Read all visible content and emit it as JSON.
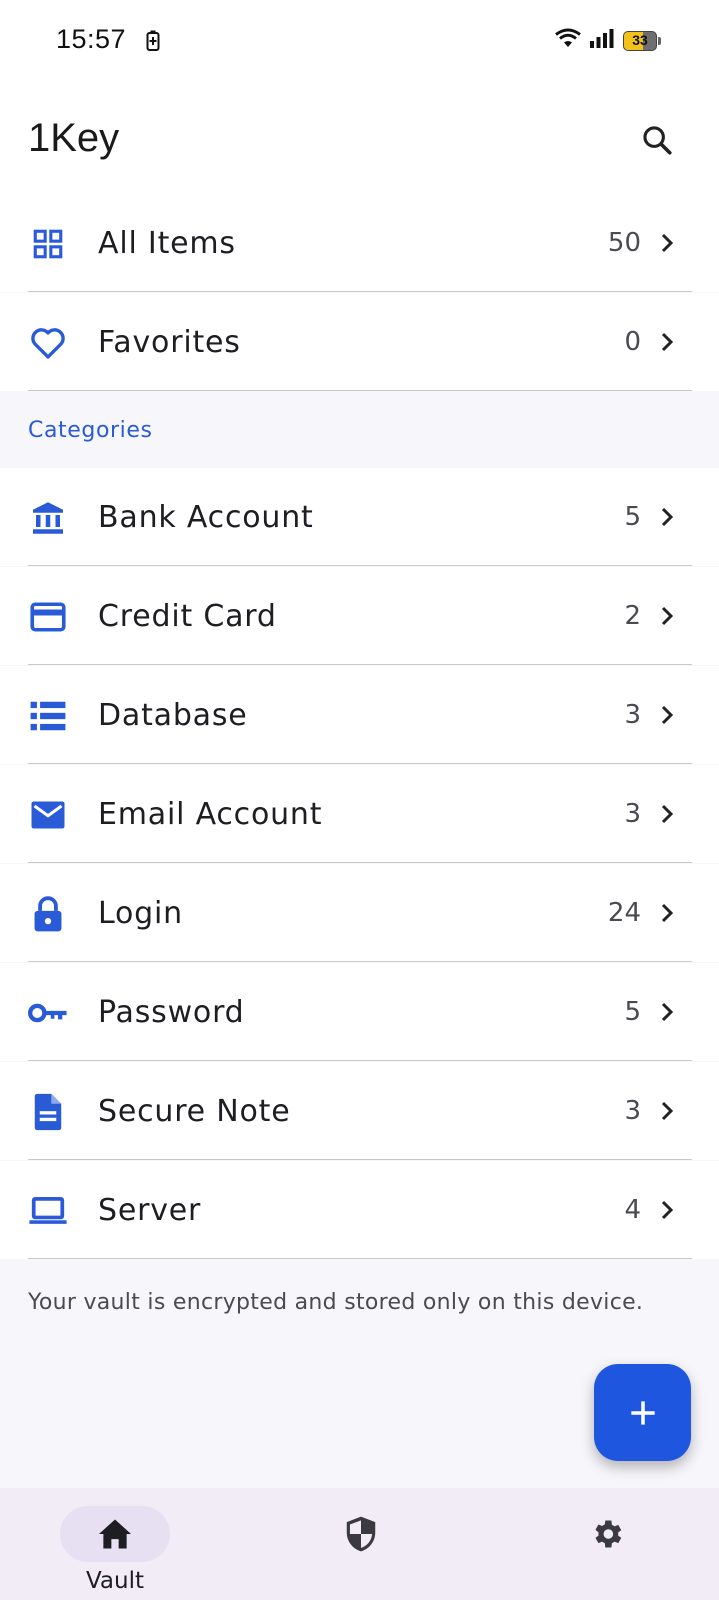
{
  "status_bar": {
    "time": "15:57",
    "battery_level": "33"
  },
  "app_bar": {
    "title": "1Key",
    "search_icon": "search-icon"
  },
  "top_items": [
    {
      "label": "All Items",
      "count": "50",
      "icon": "grid-icon"
    },
    {
      "label": "Favorites",
      "count": "0",
      "icon": "heart-icon"
    }
  ],
  "section": {
    "label": "Categories"
  },
  "categories": [
    {
      "label": "Bank Account",
      "count": "5",
      "icon": "bank-icon"
    },
    {
      "label": "Credit Card",
      "count": "2",
      "icon": "credit-card-icon"
    },
    {
      "label": "Database",
      "count": "3",
      "icon": "database-icon"
    },
    {
      "label": "Email Account",
      "count": "3",
      "icon": "email-icon"
    },
    {
      "label": "Login",
      "count": "24",
      "icon": "lock-icon"
    },
    {
      "label": "Password",
      "count": "5",
      "icon": "key-icon"
    },
    {
      "label": "Secure Note",
      "count": "3",
      "icon": "document-icon"
    },
    {
      "label": "Server",
      "count": "4",
      "icon": "laptop-icon"
    }
  ],
  "footer": {
    "note": "Your vault is encrypted and stored only on this device."
  },
  "fab": {
    "icon": "plus-icon"
  },
  "bottom_nav": [
    {
      "label": "Vault",
      "icon": "home-icon",
      "active": true
    },
    {
      "label": "",
      "icon": "shield-icon",
      "active": false
    },
    {
      "label": "",
      "icon": "gear-icon",
      "active": false
    }
  ],
  "colors": {
    "accent": "#2a5bd7",
    "fab": "#1f56e0",
    "nav_bg": "#f1ecf6",
    "nav_active_pill": "#e7e0f3"
  }
}
